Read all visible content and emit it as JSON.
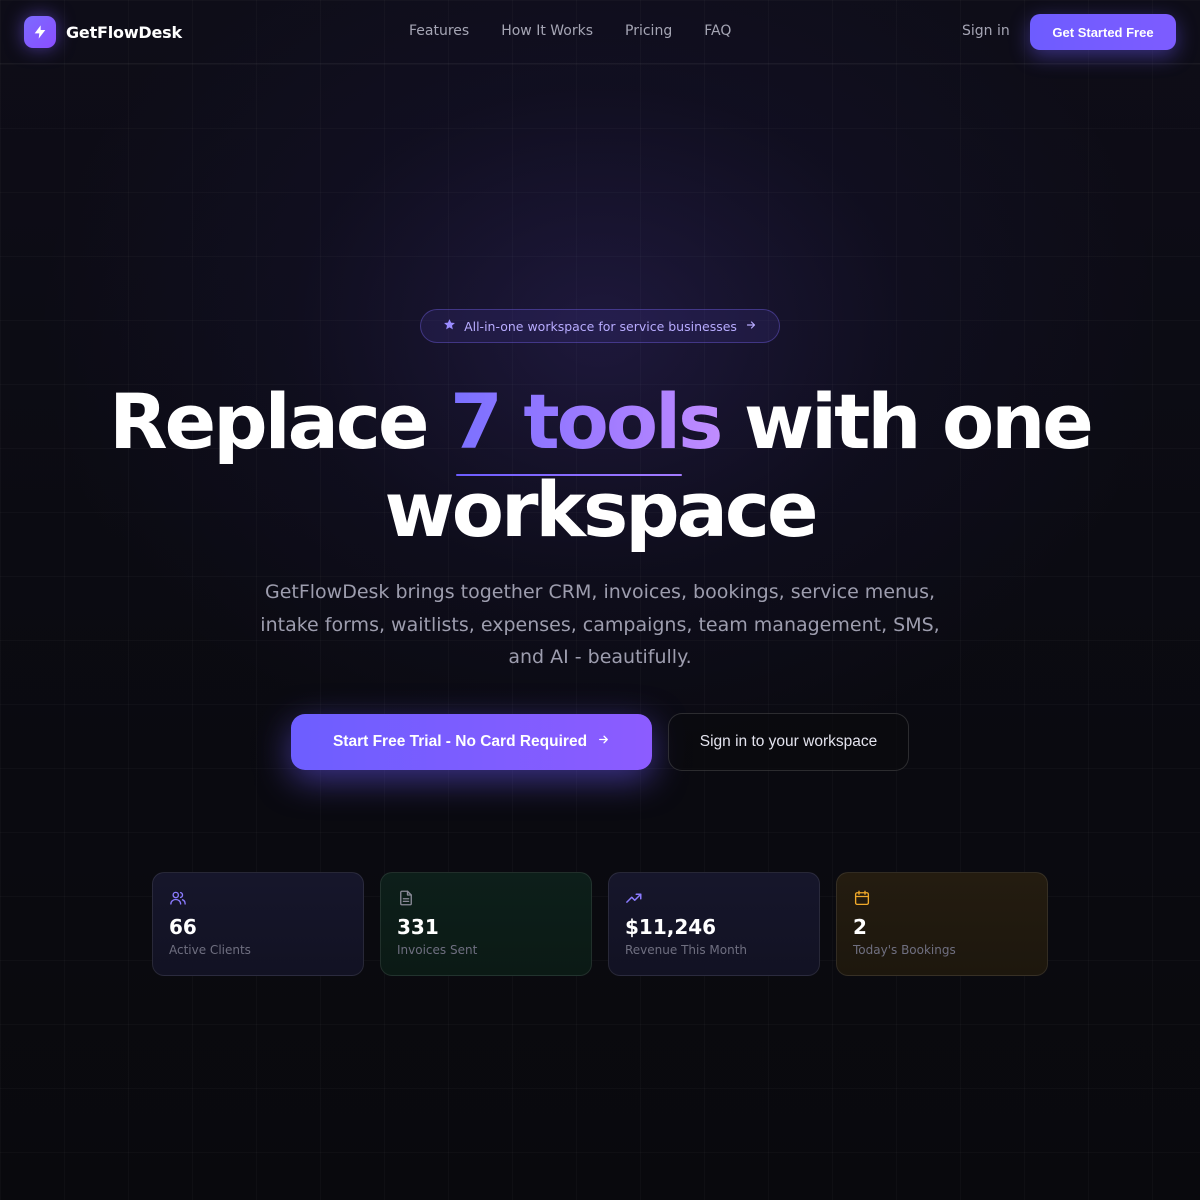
{
  "brand": {
    "name": "GetFlowDesk",
    "accent": "#7c5cff"
  },
  "nav": {
    "links": [
      "Features",
      "How It Works",
      "Pricing",
      "FAQ"
    ],
    "signin": "Sign in",
    "cta": "Get Started Free"
  },
  "hero": {
    "badge": "All-in-one workspace for service businesses",
    "headline_before": "Replace ",
    "headline_accent": "7 tools",
    "headline_after": " with one workspace",
    "subtitle": "GetFlowDesk brings together CRM, invoices, bookings, service menus, intake forms, waitlists, expenses, campaigns, team management, SMS, and AI - beautifully.",
    "cta_primary": "Start Free Trial - No Card Required",
    "cta_secondary": "Sign in to your workspace"
  },
  "stats": [
    {
      "icon": "users-icon",
      "value": "66",
      "label": "Active Clients",
      "color": "#8b7bff"
    },
    {
      "icon": "document-icon",
      "value": "331",
      "label": "Invoices Sent",
      "color": "#8a8a98"
    },
    {
      "icon": "trending-up-icon",
      "value": "$11,246",
      "label": "Revenue This Month",
      "color": "#8b7bff"
    },
    {
      "icon": "calendar-icon",
      "value": "2",
      "label": "Today's Bookings",
      "color": "#f0a92a"
    }
  ]
}
